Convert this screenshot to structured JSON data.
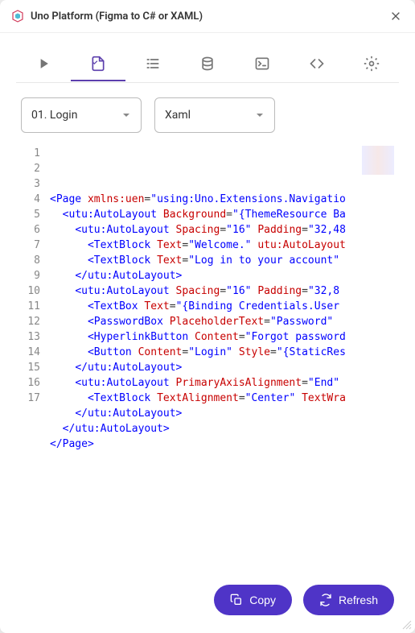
{
  "title": "Uno Platform (Figma to C# or XAML)",
  "dropdowns": {
    "page": "01. Login",
    "language": "Xaml"
  },
  "code": {
    "lines": [
      {
        "n": 1,
        "indent": 0,
        "tokens": [
          {
            "t": "punc",
            "v": "<"
          },
          {
            "t": "tag",
            "v": "Page "
          },
          {
            "t": "attr",
            "v": "xmlns:uen"
          },
          {
            "t": "eq",
            "v": "="
          },
          {
            "t": "str",
            "v": "\"using:Uno.Extensions.Navigatio"
          }
        ]
      },
      {
        "n": 2,
        "indent": 1,
        "tokens": [
          {
            "t": "punc",
            "v": "<"
          },
          {
            "t": "tag",
            "v": "utu:AutoLayout "
          },
          {
            "t": "attr",
            "v": "Background"
          },
          {
            "t": "eq",
            "v": "="
          },
          {
            "t": "str",
            "v": "\"{ThemeResource Ba"
          }
        ]
      },
      {
        "n": 3,
        "indent": 2,
        "tokens": [
          {
            "t": "punc",
            "v": "<"
          },
          {
            "t": "tag",
            "v": "utu:AutoLayout "
          },
          {
            "t": "attr",
            "v": "Spacing"
          },
          {
            "t": "eq",
            "v": "="
          },
          {
            "t": "str",
            "v": "\"16\" "
          },
          {
            "t": "attr",
            "v": "Padding"
          },
          {
            "t": "eq",
            "v": "="
          },
          {
            "t": "str",
            "v": "\"32,48"
          }
        ]
      },
      {
        "n": 4,
        "indent": 3,
        "tokens": [
          {
            "t": "punc",
            "v": "<"
          },
          {
            "t": "tag",
            "v": "TextBlock "
          },
          {
            "t": "attr",
            "v": "Text"
          },
          {
            "t": "eq",
            "v": "="
          },
          {
            "t": "str",
            "v": "\"Welcome.\" "
          },
          {
            "t": "attr",
            "v": "utu:AutoLayout"
          }
        ]
      },
      {
        "n": 5,
        "indent": 3,
        "tokens": [
          {
            "t": "punc",
            "v": "<"
          },
          {
            "t": "tag",
            "v": "TextBlock "
          },
          {
            "t": "attr",
            "v": "Text"
          },
          {
            "t": "eq",
            "v": "="
          },
          {
            "t": "str",
            "v": "\"Log in to your account\""
          }
        ]
      },
      {
        "n": 6,
        "indent": 2,
        "tokens": [
          {
            "t": "punc",
            "v": "</"
          },
          {
            "t": "tag",
            "v": "utu:AutoLayout"
          },
          {
            "t": "punc",
            "v": ">"
          }
        ]
      },
      {
        "n": 7,
        "indent": 2,
        "tokens": [
          {
            "t": "punc",
            "v": "<"
          },
          {
            "t": "tag",
            "v": "utu:AutoLayout "
          },
          {
            "t": "attr",
            "v": "Spacing"
          },
          {
            "t": "eq",
            "v": "="
          },
          {
            "t": "str",
            "v": "\"16\" "
          },
          {
            "t": "attr",
            "v": "Padding"
          },
          {
            "t": "eq",
            "v": "="
          },
          {
            "t": "str",
            "v": "\"32,8"
          }
        ]
      },
      {
        "n": 8,
        "indent": 3,
        "tokens": [
          {
            "t": "punc",
            "v": "<"
          },
          {
            "t": "tag",
            "v": "TextBox "
          },
          {
            "t": "attr",
            "v": "Text"
          },
          {
            "t": "eq",
            "v": "="
          },
          {
            "t": "str",
            "v": "\"{Binding Credentials.User"
          }
        ]
      },
      {
        "n": 9,
        "indent": 3,
        "tokens": [
          {
            "t": "punc",
            "v": "<"
          },
          {
            "t": "tag",
            "v": "PasswordBox "
          },
          {
            "t": "attr",
            "v": "PlaceholderText"
          },
          {
            "t": "eq",
            "v": "="
          },
          {
            "t": "str",
            "v": "\"Password\" "
          }
        ]
      },
      {
        "n": 10,
        "indent": 3,
        "tokens": [
          {
            "t": "punc",
            "v": "<"
          },
          {
            "t": "tag",
            "v": "HyperlinkButton "
          },
          {
            "t": "attr",
            "v": "Content"
          },
          {
            "t": "eq",
            "v": "="
          },
          {
            "t": "str",
            "v": "\"Forgot password"
          }
        ]
      },
      {
        "n": 11,
        "indent": 3,
        "tokens": [
          {
            "t": "punc",
            "v": "<"
          },
          {
            "t": "tag",
            "v": "Button "
          },
          {
            "t": "attr",
            "v": "Content"
          },
          {
            "t": "eq",
            "v": "="
          },
          {
            "t": "str",
            "v": "\"Login\" "
          },
          {
            "t": "attr",
            "v": "Style"
          },
          {
            "t": "eq",
            "v": "="
          },
          {
            "t": "str",
            "v": "\"{StaticRes"
          }
        ]
      },
      {
        "n": 12,
        "indent": 2,
        "tokens": [
          {
            "t": "punc",
            "v": "</"
          },
          {
            "t": "tag",
            "v": "utu:AutoLayout"
          },
          {
            "t": "punc",
            "v": ">"
          }
        ]
      },
      {
        "n": 13,
        "indent": 2,
        "tokens": [
          {
            "t": "punc",
            "v": "<"
          },
          {
            "t": "tag",
            "v": "utu:AutoLayout "
          },
          {
            "t": "attr",
            "v": "PrimaryAxisAlignment"
          },
          {
            "t": "eq",
            "v": "="
          },
          {
            "t": "str",
            "v": "\"End\""
          }
        ]
      },
      {
        "n": 14,
        "indent": 3,
        "tokens": [
          {
            "t": "punc",
            "v": "<"
          },
          {
            "t": "tag",
            "v": "TextBlock "
          },
          {
            "t": "attr",
            "v": "TextAlignment"
          },
          {
            "t": "eq",
            "v": "="
          },
          {
            "t": "str",
            "v": "\"Center\" "
          },
          {
            "t": "attr",
            "v": "TextWra"
          }
        ]
      },
      {
        "n": 15,
        "indent": 2,
        "tokens": [
          {
            "t": "punc",
            "v": "</"
          },
          {
            "t": "tag",
            "v": "utu:AutoLayout"
          },
          {
            "t": "punc",
            "v": ">"
          }
        ]
      },
      {
        "n": 16,
        "indent": 1,
        "tokens": [
          {
            "t": "punc",
            "v": "</"
          },
          {
            "t": "tag",
            "v": "utu:AutoLayout"
          },
          {
            "t": "punc",
            "v": ">"
          }
        ]
      },
      {
        "n": 17,
        "indent": 0,
        "tokens": [
          {
            "t": "punc",
            "v": "</"
          },
          {
            "t": "tag",
            "v": "Page"
          },
          {
            "t": "punc",
            "v": ">"
          }
        ]
      }
    ]
  },
  "buttons": {
    "copy": "Copy",
    "refresh": "Refresh"
  }
}
